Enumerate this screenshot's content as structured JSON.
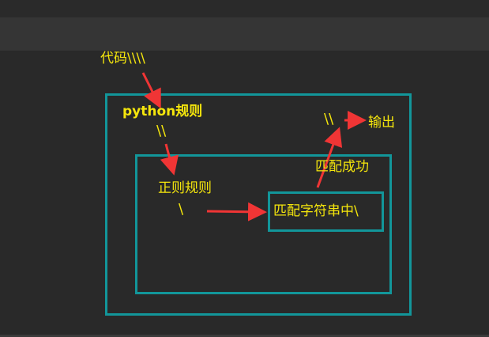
{
  "labels": {
    "code": "代码\\\\\\\\",
    "python_rule": "python规则",
    "python_rule_chars": "\\\\",
    "regex_rule": "正则规则",
    "regex_rule_char": "\\",
    "match_string": "匹配字符串中\\",
    "match_success": "匹配成功",
    "output_chars": "\\\\",
    "output": "输出"
  },
  "colors": {
    "background": "#292929",
    "box_border": "#12969a",
    "label_text": "#f5e60c",
    "arrow": "#f03535"
  }
}
